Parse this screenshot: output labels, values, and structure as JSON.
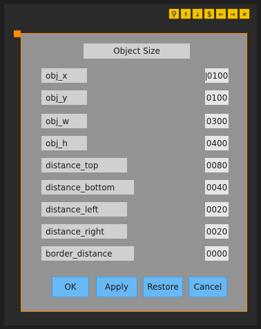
{
  "window": {
    "title": "Object Size"
  },
  "toolbar": {
    "buttons": [
      {
        "glyph": "⚲",
        "name": "pin-icon"
      },
      {
        "glyph": "↑",
        "name": "arrow-up-icon"
      },
      {
        "glyph": "↓",
        "name": "arrow-down-icon"
      },
      {
        "glyph": "$",
        "name": "dollar-icon"
      },
      {
        "glyph": "←",
        "name": "arrow-left-icon"
      },
      {
        "glyph": "→",
        "name": "arrow-right-icon"
      },
      {
        "glyph": "×",
        "name": "close-icon"
      }
    ]
  },
  "fields": [
    {
      "label": "obj_x",
      "value": "0100"
    },
    {
      "label": "obj_y",
      "value": "0100"
    },
    {
      "label": "obj_w",
      "value": "0300"
    },
    {
      "label": "obj_h",
      "value": "0400"
    },
    {
      "label": "distance_top",
      "value": "0080"
    },
    {
      "label": "distance_bottom",
      "value": "0040"
    },
    {
      "label": "distance_left",
      "value": "0020"
    },
    {
      "label": "distance_right",
      "value": "0020"
    },
    {
      "label": "border_distance",
      "value": "0000"
    }
  ],
  "buttons": {
    "ok": "OK",
    "apply": "Apply",
    "restore": "Restore",
    "cancel": "Cancel"
  },
  "colors": {
    "accent_orange": "#ff8a00",
    "toolbar_yellow": "#f3c300",
    "dialog_bg": "#939393",
    "button_blue": "#67b8f3"
  }
}
